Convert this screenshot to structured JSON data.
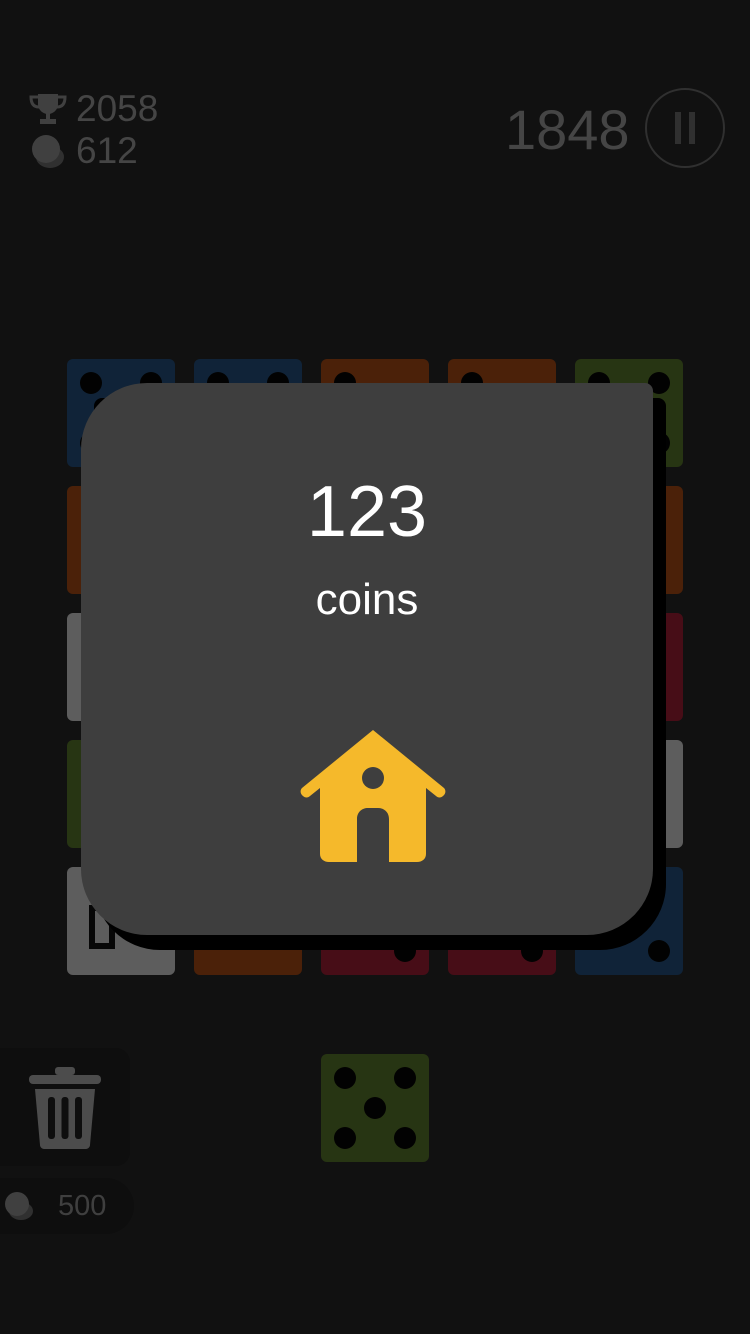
{
  "hud": {
    "best_score": "2058",
    "coins": "612",
    "score": "1848",
    "trophy_icon": "trophy-icon",
    "coin_icon": "coin-stack-icon",
    "pause_icon": "pause-icon"
  },
  "board": {
    "rows": 5,
    "cols": 5,
    "colors": {
      "blue": "#244f7c",
      "orange": "#a64a14",
      "green": "#58752a",
      "red": "#9e1e33",
      "white": "#cfcfcf"
    },
    "tiles": [
      {
        "row": 0,
        "col": 0,
        "color": "blue",
        "value": 4
      },
      {
        "row": 0,
        "col": 1,
        "color": "blue",
        "value": 4
      },
      {
        "row": 0,
        "col": 2,
        "color": "orange",
        "value": 2
      },
      {
        "row": 0,
        "col": 3,
        "color": "orange",
        "value": 2
      },
      {
        "row": 0,
        "col": 4,
        "color": "green",
        "value": 4
      },
      {
        "row": 1,
        "col": 0,
        "color": "orange",
        "value": 1
      },
      {
        "row": 1,
        "col": 4,
        "color": "orange",
        "value": 1
      },
      {
        "row": 2,
        "col": 0,
        "color": "white",
        "value": 1
      },
      {
        "row": 2,
        "col": 4,
        "color": "red",
        "value": 1
      },
      {
        "row": 3,
        "col": 0,
        "color": "green",
        "value": 1
      },
      {
        "row": 3,
        "col": 4,
        "color": "white",
        "value": 1
      },
      {
        "row": 4,
        "col": 0,
        "color": "white",
        "value": 0
      },
      {
        "row": 4,
        "col": 1,
        "color": "orange",
        "value": 1
      },
      {
        "row": 4,
        "col": 2,
        "color": "red",
        "value": 2
      },
      {
        "row": 4,
        "col": 3,
        "color": "red",
        "value": 2
      },
      {
        "row": 4,
        "col": 4,
        "color": "blue",
        "value": 2
      }
    ]
  },
  "tools": {
    "trash_icon": "trash-icon",
    "trash_cost": "500",
    "next_die": {
      "color": "green",
      "value": 5
    }
  },
  "dialog": {
    "amount": "123",
    "label": "coins",
    "home_icon": "home-icon",
    "home_color": "#f5b92b"
  }
}
